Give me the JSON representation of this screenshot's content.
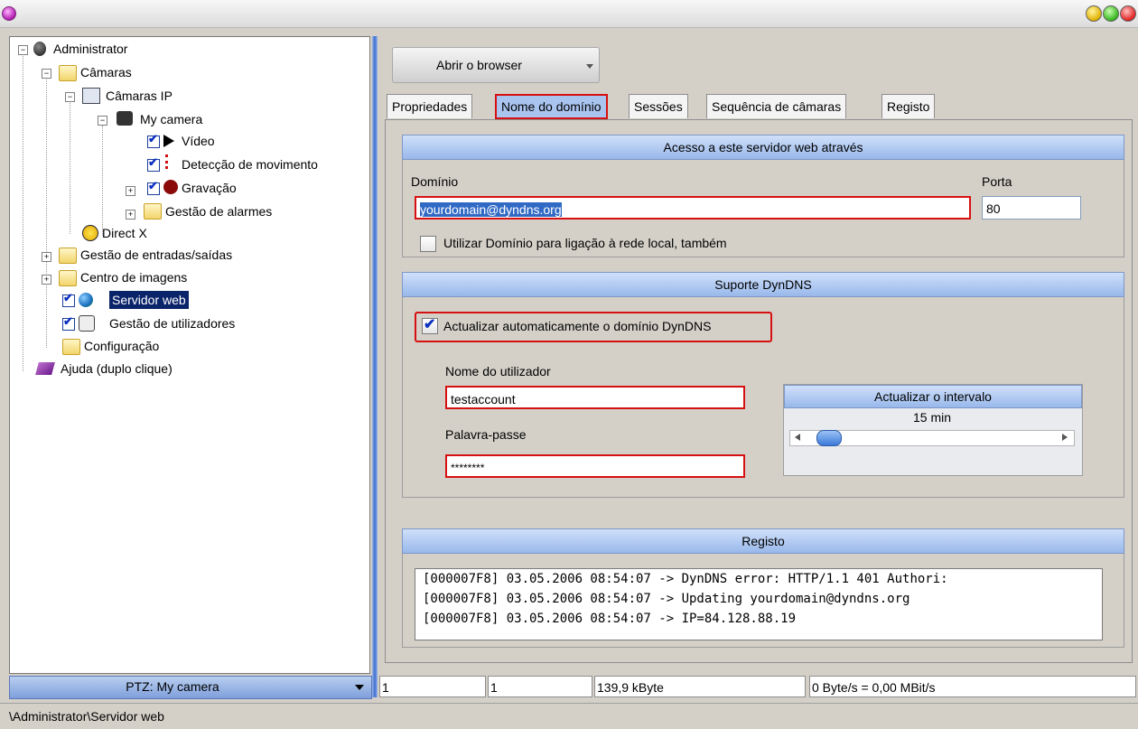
{
  "window": {
    "title": ""
  },
  "tree": {
    "items": [
      {
        "label": "Administrator"
      },
      {
        "label": "Câmaras"
      },
      {
        "label": "Câmaras IP"
      },
      {
        "label": "My camera"
      },
      {
        "label": "Vídeo"
      },
      {
        "label": "Detecção de movimento"
      },
      {
        "label": "Gravação"
      },
      {
        "label": "Gestão de alarmes"
      },
      {
        "label": "Direct X"
      },
      {
        "label": "Gestão de entradas/saídas"
      },
      {
        "label": "Centro de imagens"
      },
      {
        "label": "Servidor web"
      },
      {
        "label": "Gestão de utilizadores"
      },
      {
        "label": "Configuração"
      },
      {
        "label": "Ajuda (duplo clique)"
      }
    ],
    "selected": "Servidor web"
  },
  "ptz": {
    "label": "PTZ: My camera"
  },
  "toolbar": {
    "browser_button": "Abrir o browser"
  },
  "tabs": [
    "Propriedades",
    "Nome do domínio",
    "Sessões",
    "Sequência de câmaras",
    "Registo"
  ],
  "active_tab": "Nome do domínio",
  "access": {
    "header": "Acesso a este servidor web através",
    "domain_label": "Domínio",
    "domain_value": "yourdomain@dyndns.org",
    "port_label": "Porta",
    "port_value": "80",
    "local_checkbox_label": "Utilizar Domínio para ligação à rede local, também",
    "local_checked": false
  },
  "dyndns": {
    "header": "Suporte DynDNS",
    "auto_update_label": "Actualizar automaticamente o domínio DynDNS",
    "auto_update_checked": true,
    "user_label": "Nome do utilizador",
    "user_value": "testaccount",
    "password_label": "Palavra-passe",
    "password_value": "********",
    "interval_header": "Actualizar o intervalo",
    "interval_value": "15 min"
  },
  "log": {
    "header": "Registo",
    "lines": [
      "[000007F8] 03.05.2006 08:54:07 -> DynDNS error: HTTP/1.1 401 Authori:",
      "[000007F8] 03.05.2006 08:54:07 -> Updating yourdomain@dyndns.org",
      "[000007F8] 03.05.2006 08:54:07 -> IP=84.128.88.19"
    ]
  },
  "status": {
    "cell1": "1",
    "cell2": "1",
    "size": "139,9 kByte",
    "rate": "0 Byte/s = 0,00 MBit/s"
  },
  "path": "\\Administrator\\Servidor web",
  "colors": {
    "accent_red": "#d61010",
    "selection": "#0a246a",
    "header_blue": "#98b8ea"
  }
}
